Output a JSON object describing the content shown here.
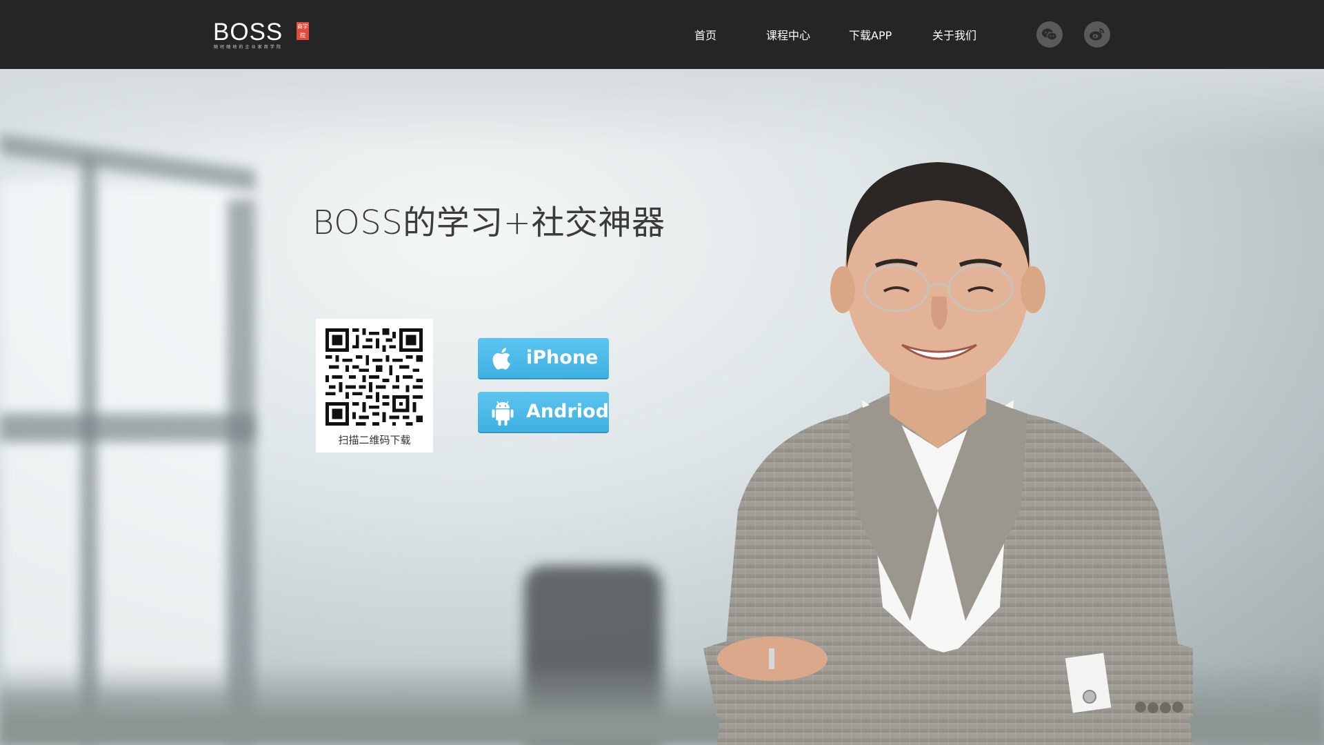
{
  "header": {
    "logo": {
      "word": "BOSS",
      "badge": "商学院",
      "tagline": "随时随地的企业家商学院"
    },
    "nav": [
      {
        "label": "首页"
      },
      {
        "label": "课程中心"
      },
      {
        "label": "下载APP"
      },
      {
        "label": "关于我们"
      }
    ],
    "social": [
      {
        "icon": "wechat-icon"
      },
      {
        "icon": "weibo-icon"
      }
    ]
  },
  "hero": {
    "headline": "BOSS的学习+社交神器",
    "qr": {
      "caption": "扫描二维码下载"
    },
    "buttons": [
      {
        "label": "iPhone",
        "icon": "apple-icon"
      },
      {
        "label": "Andriod",
        "icon": "android-icon"
      }
    ]
  },
  "colors": {
    "header_bg": "#252525",
    "button_blue": "#4ab8e8",
    "logo_accent": "#e14b39"
  }
}
